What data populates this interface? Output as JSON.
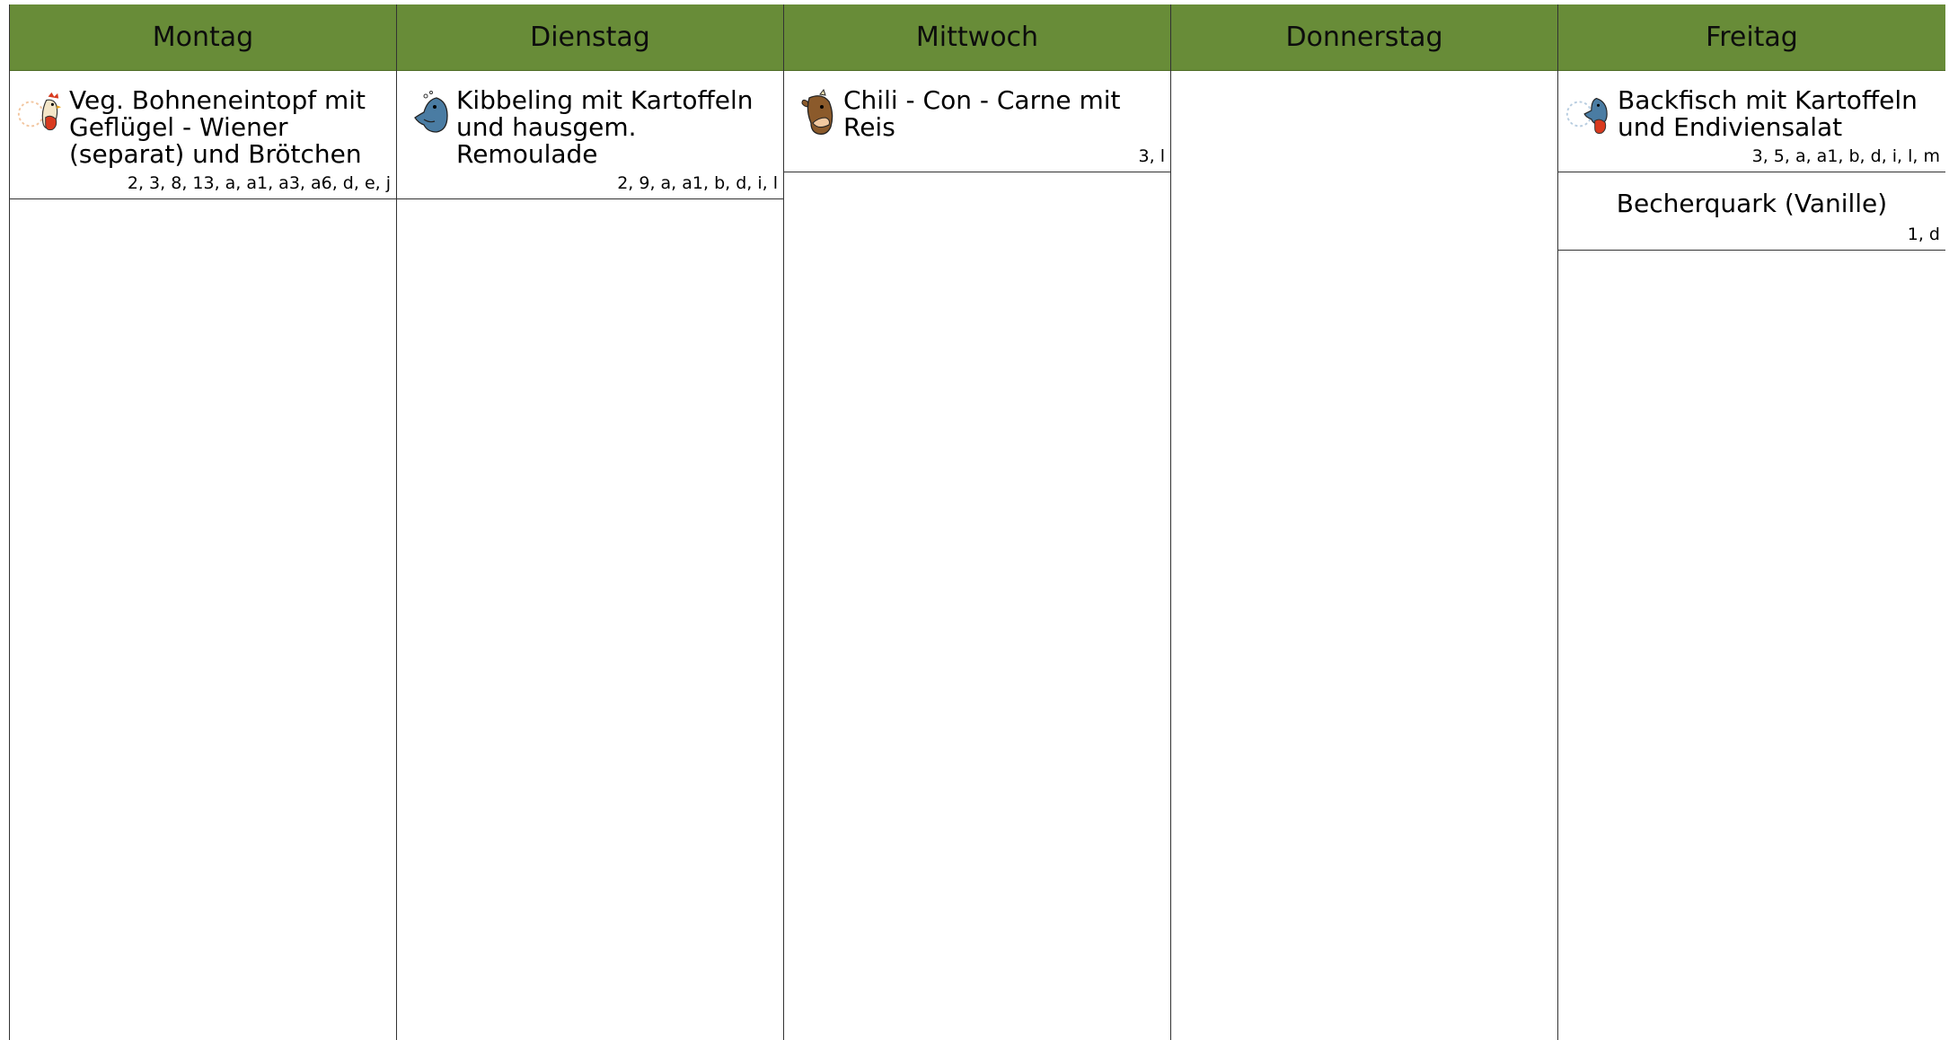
{
  "days": [
    {
      "name": "Montag",
      "meals": [
        {
          "icon": "chicken-icon",
          "title": "Veg. Bohneneintopf mit Geflügel - Wiener (separat) und Brötchen",
          "allergens": "2, 3, 8, 13, a, a1, a3, a6, d, e, j"
        }
      ]
    },
    {
      "name": "Dienstag",
      "meals": [
        {
          "icon": "fish-icon",
          "title": "Kibbeling mit Kartoffeln und hausgem. Remoulade",
          "allergens": "2, 9, a, a1, b, d, i, l"
        }
      ]
    },
    {
      "name": "Mittwoch",
      "meals": [
        {
          "icon": "cow-icon",
          "title": "Chili - Con - Carne mit Reis",
          "allergens": "3, l"
        }
      ]
    },
    {
      "name": "Donnerstag",
      "meals": []
    },
    {
      "name": "Freitag",
      "meals": [
        {
          "icon": "fish-icon",
          "title": "Backfisch mit Kartoffeln und Endiviensalat",
          "allergens": "3, 5, a, a1, b, d, i, l, m"
        },
        {
          "icon": "",
          "title": "Becherquark (Vanille)",
          "allergens": "1, d"
        }
      ]
    }
  ],
  "colors": {
    "header_bg": "#688c38",
    "fish": "#4a7ca3",
    "cow": "#8b5a2b",
    "chicken_comb": "#d93a1f"
  }
}
